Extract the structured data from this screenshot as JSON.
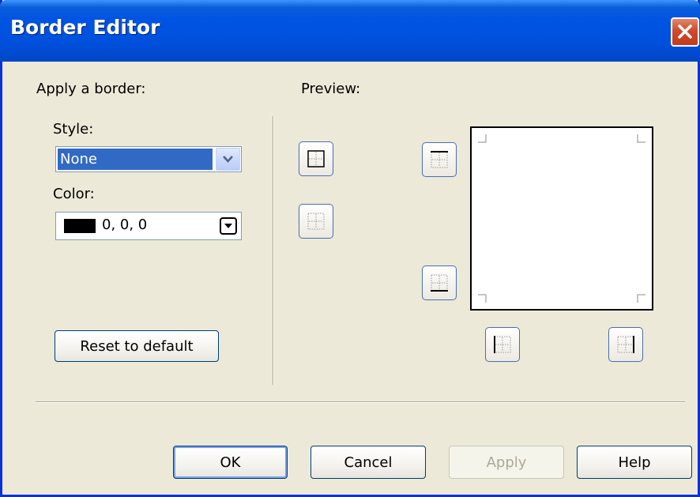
{
  "window": {
    "title": "Border Editor"
  },
  "apply_section": {
    "heading": "Apply a border:",
    "style_label": "Style:",
    "style_value": "None",
    "color_label": "Color:",
    "color_value": "0, 0, 0",
    "color_swatch": "#000000",
    "reset_label": "Reset to default"
  },
  "preview_section": {
    "heading": "Preview:",
    "buttons": [
      "border-all-icon",
      "border-none-icon",
      "border-top-icon",
      "border-bottom-icon",
      "border-left-icon",
      "border-right-icon"
    ]
  },
  "footer": {
    "ok_label": "OK",
    "cancel_label": "Cancel",
    "apply_label": "Apply",
    "help_label": "Help"
  },
  "colors": {
    "title_bar": "#0054e3",
    "dialog_bg": "#ece9d8",
    "selection": "#316ac5",
    "close": "#d0492b"
  }
}
